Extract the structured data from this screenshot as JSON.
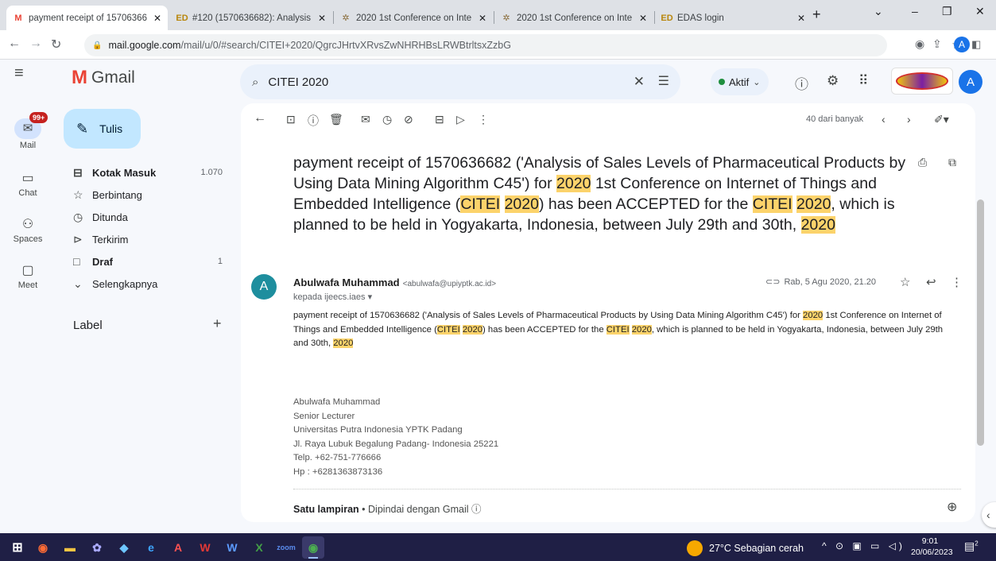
{
  "browser": {
    "tabs": [
      {
        "title": "payment receipt of 15706366",
        "favicon": "gmail-icon",
        "active": true
      },
      {
        "title": "#120 (1570636682): Analysis",
        "favicon": "edas-icon",
        "active": false
      },
      {
        "title": "2020 1st Conference on Inte",
        "favicon": "conference-icon",
        "active": false
      },
      {
        "title": "2020 1st Conference on Inte",
        "favicon": "conference-icon",
        "active": false
      },
      {
        "title": "EDAS login",
        "favicon": "edas-icon",
        "active": false
      }
    ],
    "url_host": "mail.google.com",
    "url_path": "/mail/u/0/#search/CITEI+2020/QgrcJHrtvXRvsZwNHRHBsLRWBtrltsxZzbG",
    "profile_initial": "A"
  },
  "gmail": {
    "app_name": "Gmail",
    "search_value": "CITEI 2020",
    "status_label": "Aktif",
    "avatar_initial": "A",
    "rail": {
      "mail_label": "Mail",
      "mail_badge": "99+",
      "chat_label": "Chat",
      "spaces_label": "Spaces",
      "meet_label": "Meet"
    },
    "compose_label": "Tulis",
    "folders": [
      {
        "label": "Kotak Masuk",
        "count": "1.070",
        "bold": true,
        "icon": "inbox-icon",
        "glyph": "⊟"
      },
      {
        "label": "Berbintang",
        "count": "",
        "bold": false,
        "icon": "star-icon",
        "glyph": "☆"
      },
      {
        "label": "Ditunda",
        "count": "",
        "bold": false,
        "icon": "clock-icon",
        "glyph": "◷"
      },
      {
        "label": "Terkirim",
        "count": "",
        "bold": false,
        "icon": "send-icon",
        "glyph": "⊳"
      },
      {
        "label": "Draf",
        "count": "1",
        "bold": true,
        "icon": "draft-icon",
        "glyph": "□"
      },
      {
        "label": "Selengkapnya",
        "count": "",
        "bold": false,
        "icon": "chevron-down-icon",
        "glyph": "⌄"
      }
    ],
    "label_header": "Label",
    "page_count": "40 dari banyak"
  },
  "email": {
    "subject": {
      "p1": "payment receipt of 1570636682 ('Analysis of Sales Levels of Pharmaceutical Products by Using Data Mining Algorithm C45') for ",
      "h1": "2020",
      "p2": " 1st Conference on Internet of Things and Embedded Intelligence (",
      "h2": "CITEI",
      "p3": " ",
      "h3": "2020",
      "p4": ") has been ACCEPTED for the ",
      "h4": "CITEI",
      "p5": " ",
      "h5": "2020",
      "p6": ", which is planned to be held in Yogyakarta, Indonesia, between July 29th and 30th, ",
      "h6": "2020"
    },
    "sender_name": "Abulwafa Muhammad",
    "sender_email": "<abulwafa@upiyptk.ac.id>",
    "recipient": "kepada ijeecs.iaes",
    "date": "Rab, 5 Agu 2020, 21.20",
    "body": {
      "p1": "payment receipt  of 1570636682 ('Analysis of Sales Levels of Pharmaceutical Products by Using Data Mining Algorithm C45') for ",
      "h1": "2020",
      "p2": " 1st Conference on Internet of Things and Embedded Intelligence (",
      "h2": "CITEI",
      "p3": " ",
      "h3": "2020",
      "p4": ") has been ACCEPTED for the ",
      "h4": "CITEI",
      "p5": " ",
      "h5": "2020",
      "p6": ", which is planned to be held in Yogyakarta, Indonesia, between July 29th and 30th, ",
      "h6": "2020"
    },
    "signature": [
      "Abulwafa Muhammad",
      "Senior Lecturer",
      "Universitas Putra Indonesia YPTK Padang",
      "Jl. Raya Lubuk Begalung Padang- Indonesia 25221",
      "Telp. +62-751-776666",
      "Hp : +6281363873136"
    ],
    "attachment_label": "Satu lampiran",
    "scanned_label": "Dipindai dengan Gmail"
  },
  "taskbar": {
    "weather": "27°C  Sebagian cerah",
    "time": "9:01",
    "date": "20/06/2023",
    "notification_count": "2"
  },
  "colors": {
    "highlight": "#fcd36b",
    "compose": "#c2e7ff",
    "search_bg": "#eaf1fb",
    "taskbar": "#1f1f45"
  }
}
